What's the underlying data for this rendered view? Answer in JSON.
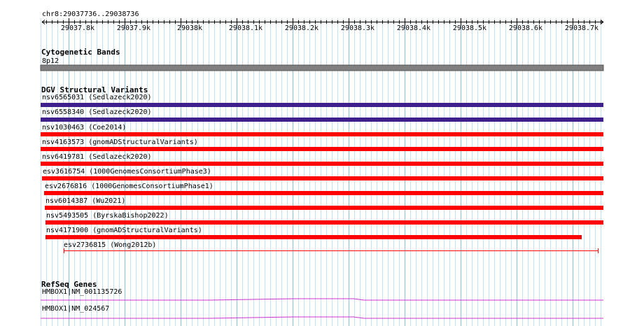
{
  "ruler": {
    "location": "chr8:29037736..29038736",
    "ticks": [
      "29037.8k",
      "29037.9k",
      "29038k",
      "29038.1k",
      "29038.2k",
      "29038.3k",
      "29038.4k",
      "29038.5k",
      "29038.6k",
      "29038.7k"
    ]
  },
  "tracks": {
    "cytoband": {
      "title": "Cytogenetic Bands",
      "band": "8p12"
    },
    "dgv": {
      "title": "DGV Structural Variants",
      "features": [
        {
          "label": "nsv6565031 (Sedlazeck2020)",
          "color": "#3f1f8c",
          "style": "bar"
        },
        {
          "label": "nsv6558340 (Sedlazeck2020)",
          "color": "#3f1f8c",
          "style": "bar"
        },
        {
          "label": "nsv1030463 (Coe2014)",
          "color": "#ff0000",
          "style": "bar"
        },
        {
          "label": "nsv4163573 (gnomADStructuralVariants)",
          "color": "#ff0000",
          "style": "bar"
        },
        {
          "label": "nsv6419781 (Sedlazeck2020)",
          "color": "#ff0000",
          "style": "bar"
        },
        {
          "label": "esv3616754 (1000GenomesConsortiumPhase3)",
          "color": "#ff0000",
          "style": "bar"
        },
        {
          "label": "esv2676816 (1000GenomesConsortiumPhase1)",
          "color": "#ff0000",
          "style": "bar"
        },
        {
          "label": "nsv6014387 (Wu2021)",
          "color": "#ff0000",
          "style": "bar"
        },
        {
          "label": "nsv5493505 (ByrskaBishop2022)",
          "color": "#ff0000",
          "style": "bar"
        },
        {
          "label": "nsv4171900 (gnomADStructuralVariants)",
          "color": "#ff0000",
          "style": "bar"
        },
        {
          "label": "esv2736815 (Wong2012b)",
          "color": "#ff0000",
          "style": "line"
        }
      ]
    },
    "refseq": {
      "title": "RefSeq Genes",
      "features": [
        {
          "label": "HMBOX1|NM_001135726",
          "color": "#cc33cc"
        },
        {
          "label": "HMBOX1|NM_024567",
          "color": "#cc33cc"
        }
      ]
    }
  }
}
